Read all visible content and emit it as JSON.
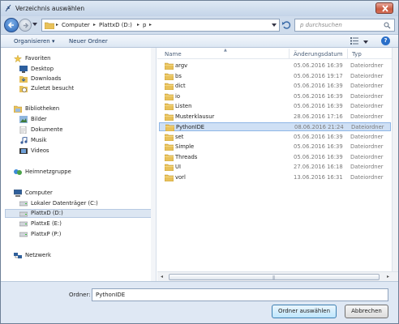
{
  "window": {
    "title": "Verzeichnis auswählen"
  },
  "address": {
    "breadcrumbs": [
      "Computer",
      "PlattxD (D:)",
      "p"
    ]
  },
  "search": {
    "placeholder": "p durchsuchen"
  },
  "toolbar": {
    "organize_label": "Organisieren ▾",
    "new_folder_label": "Neuer Ordner"
  },
  "sidebar": {
    "favorites": {
      "label": "Favoriten",
      "items": [
        "Desktop",
        "Downloads",
        "Zuletzt besucht"
      ]
    },
    "libraries": {
      "label": "Bibliotheken",
      "items": [
        "Bilder",
        "Dokumente",
        "Musik",
        "Videos"
      ]
    },
    "homegroup": {
      "label": "Heimnetzgruppe"
    },
    "computer": {
      "label": "Computer",
      "items": [
        "Lokaler Datenträger (C:)",
        "PlattxD (D:)",
        "PlattxE (E:)",
        "PlattxP (P:)"
      ],
      "selected_index": 1
    },
    "network": {
      "label": "Netzwerk"
    }
  },
  "columns": {
    "name": "Name",
    "date": "Änderungsdatum",
    "type": "Typ"
  },
  "files": [
    {
      "name": "argv",
      "date": "05.06.2016 16:39",
      "type": "Dateiordner"
    },
    {
      "name": "bs",
      "date": "05.06.2016 19:17",
      "type": "Dateiordner"
    },
    {
      "name": "dict",
      "date": "05.06.2016 16:39",
      "type": "Dateiordner"
    },
    {
      "name": "io",
      "date": "05.06.2016 16:39",
      "type": "Dateiordner"
    },
    {
      "name": "Listen",
      "date": "05.06.2016 16:39",
      "type": "Dateiordner"
    },
    {
      "name": "Musterklausur",
      "date": "28.06.2016 17:16",
      "type": "Dateiordner"
    },
    {
      "name": "PythonIDE",
      "date": "08.06.2016 21:24",
      "type": "Dateiordner"
    },
    {
      "name": "set",
      "date": "05.06.2016 16:39",
      "type": "Dateiordner"
    },
    {
      "name": "Simple",
      "date": "05.06.2016 16:39",
      "type": "Dateiordner"
    },
    {
      "name": "Threads",
      "date": "05.06.2016 16:39",
      "type": "Dateiordner"
    },
    {
      "name": "UI",
      "date": "27.06.2016 16:18",
      "type": "Dateiordner"
    },
    {
      "name": "vorl",
      "date": "13.06.2016 16:31",
      "type": "Dateiordner"
    }
  ],
  "selected_file_index": 6,
  "folder_field": {
    "label": "Ordner:",
    "value": "PythonIDE"
  },
  "buttons": {
    "confirm": "Ordner auswählen",
    "cancel": "Abbrechen"
  },
  "colors": {
    "selection": "#cfe0f5",
    "link": "#1e3c64",
    "folder": "#e8c15a"
  }
}
